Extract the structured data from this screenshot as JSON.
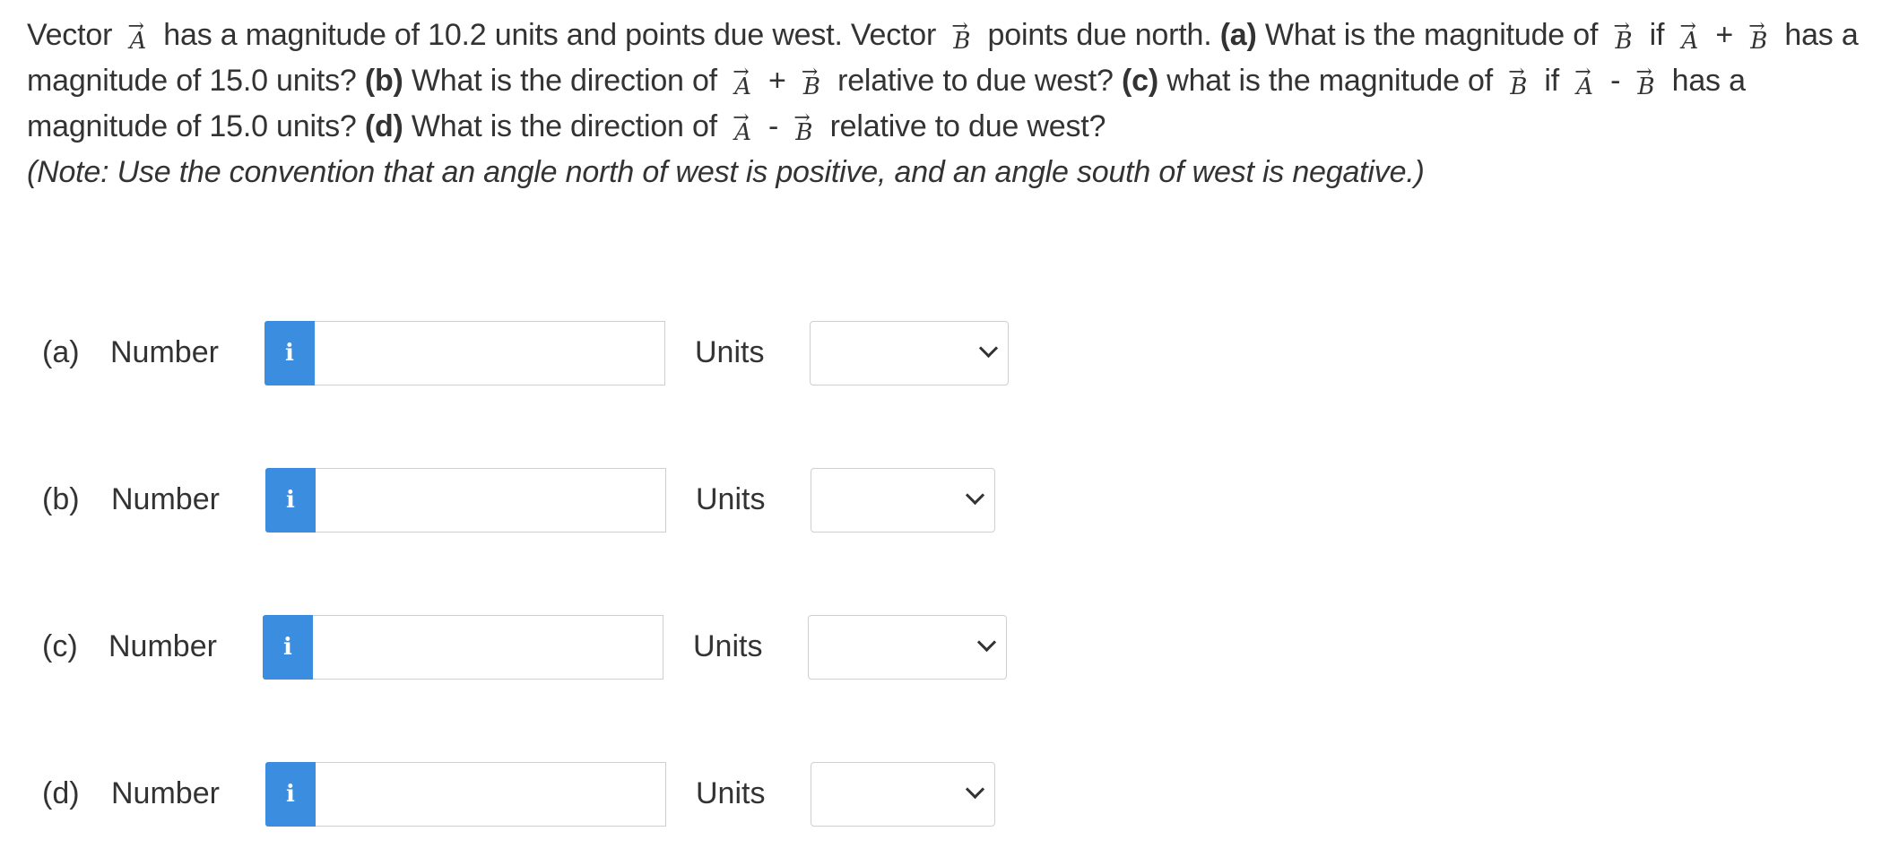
{
  "question": {
    "t1": "Vector",
    "vecA": "A",
    "vecB": "B",
    "arrow": "→",
    "t2": "has a magnitude of 10.2 units and points due west. Vector",
    "t3": "points due north.",
    "a_label": "(a)",
    "t4": "What is the magnitude of",
    "if": "if",
    "plus": "+",
    "minus": "-",
    "t5": "has a magnitude of 15.0 units?",
    "b_label": "(b)",
    "t6": "What is the direction of",
    "t7": "relative to due west?",
    "c_label": "(c)",
    "t8": "what is the magnitude of",
    "t9": "has a magnitude of 15.0 units?",
    "d_label": "(d)",
    "t10": "What is the direction of",
    "t11": "relative to due west?",
    "note": "(Note: Use the convention that an angle north of west is positive, and an angle south of west is negative.)"
  },
  "answers": [
    {
      "part": "(a)",
      "number_label": "Number",
      "info_icon": "i",
      "value": "",
      "units_label": "Units",
      "units_value": ""
    },
    {
      "part": "(b)",
      "number_label": "Number",
      "info_icon": "i",
      "value": "",
      "units_label": "Units",
      "units_value": ""
    },
    {
      "part": "(c)",
      "number_label": "Number",
      "info_icon": "i",
      "value": "",
      "units_label": "Units",
      "units_value": ""
    },
    {
      "part": "(d)",
      "number_label": "Number",
      "info_icon": "i",
      "value": "",
      "units_label": "Units",
      "units_value": ""
    }
  ],
  "colors": {
    "info_button": "#3b8de0",
    "text": "#333333",
    "border": "#cfcfcf"
  }
}
